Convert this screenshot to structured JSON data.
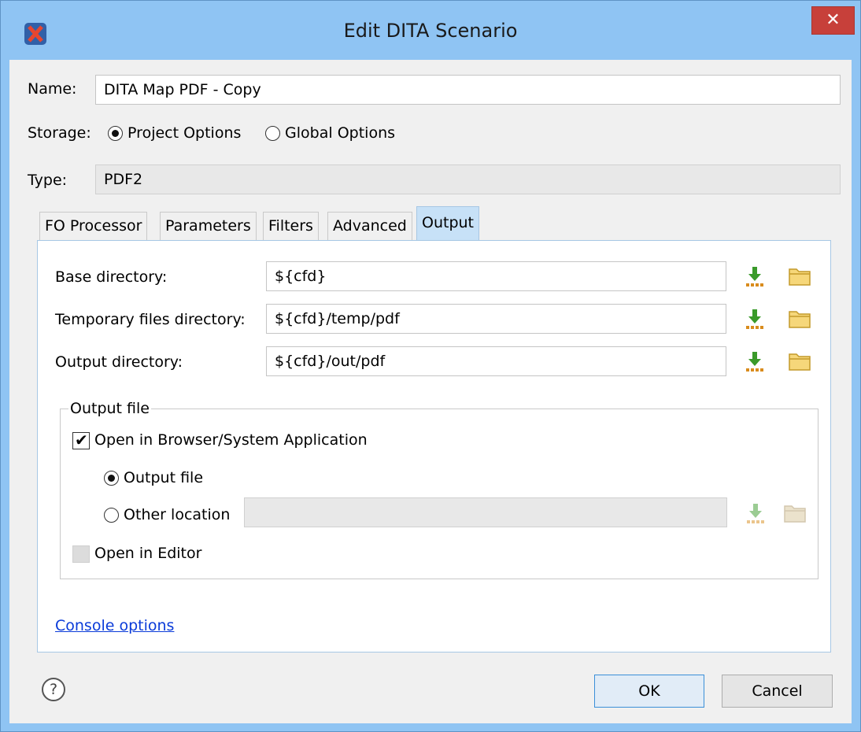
{
  "window": {
    "title": "Edit DITA Scenario",
    "close_glyph": "✕"
  },
  "form": {
    "name_label": "Name:",
    "name_value": "DITA Map PDF - Copy",
    "storage_label": "Storage:",
    "storage_project": "Project Options",
    "storage_global": "Global Options",
    "type_label": "Type:",
    "type_value": "PDF2"
  },
  "tabs": [
    {
      "label": "FO Processor"
    },
    {
      "label": "Parameters"
    },
    {
      "label": "Filters"
    },
    {
      "label": "Advanced"
    },
    {
      "label": "Output"
    }
  ],
  "output": {
    "base_label": "Base directory:",
    "base_value": "${cfd}",
    "temp_label": "Temporary files directory:",
    "temp_value": "${cfd}/temp/pdf",
    "out_label": "Output directory:",
    "out_value": "${cfd}/out/pdf",
    "group_title": "Output file",
    "open_browser": "Open in Browser/System Application",
    "opt_output_file": "Output file",
    "opt_other_location": "Other location",
    "other_location_value": "",
    "open_editor": "Open in Editor",
    "console_link": "Console options"
  },
  "buttons": {
    "ok": "OK",
    "cancel": "Cancel",
    "help": "?"
  },
  "icons": {
    "insert": "insert-editor-variables-icon",
    "browse": "folder-browse-icon",
    "app": "oxygen-x-logo-icon"
  },
  "colors": {
    "titlebar": "#8fc4f3",
    "close": "#c7403a",
    "accent": "#3b8fd8",
    "link": "#0a3bd9"
  }
}
